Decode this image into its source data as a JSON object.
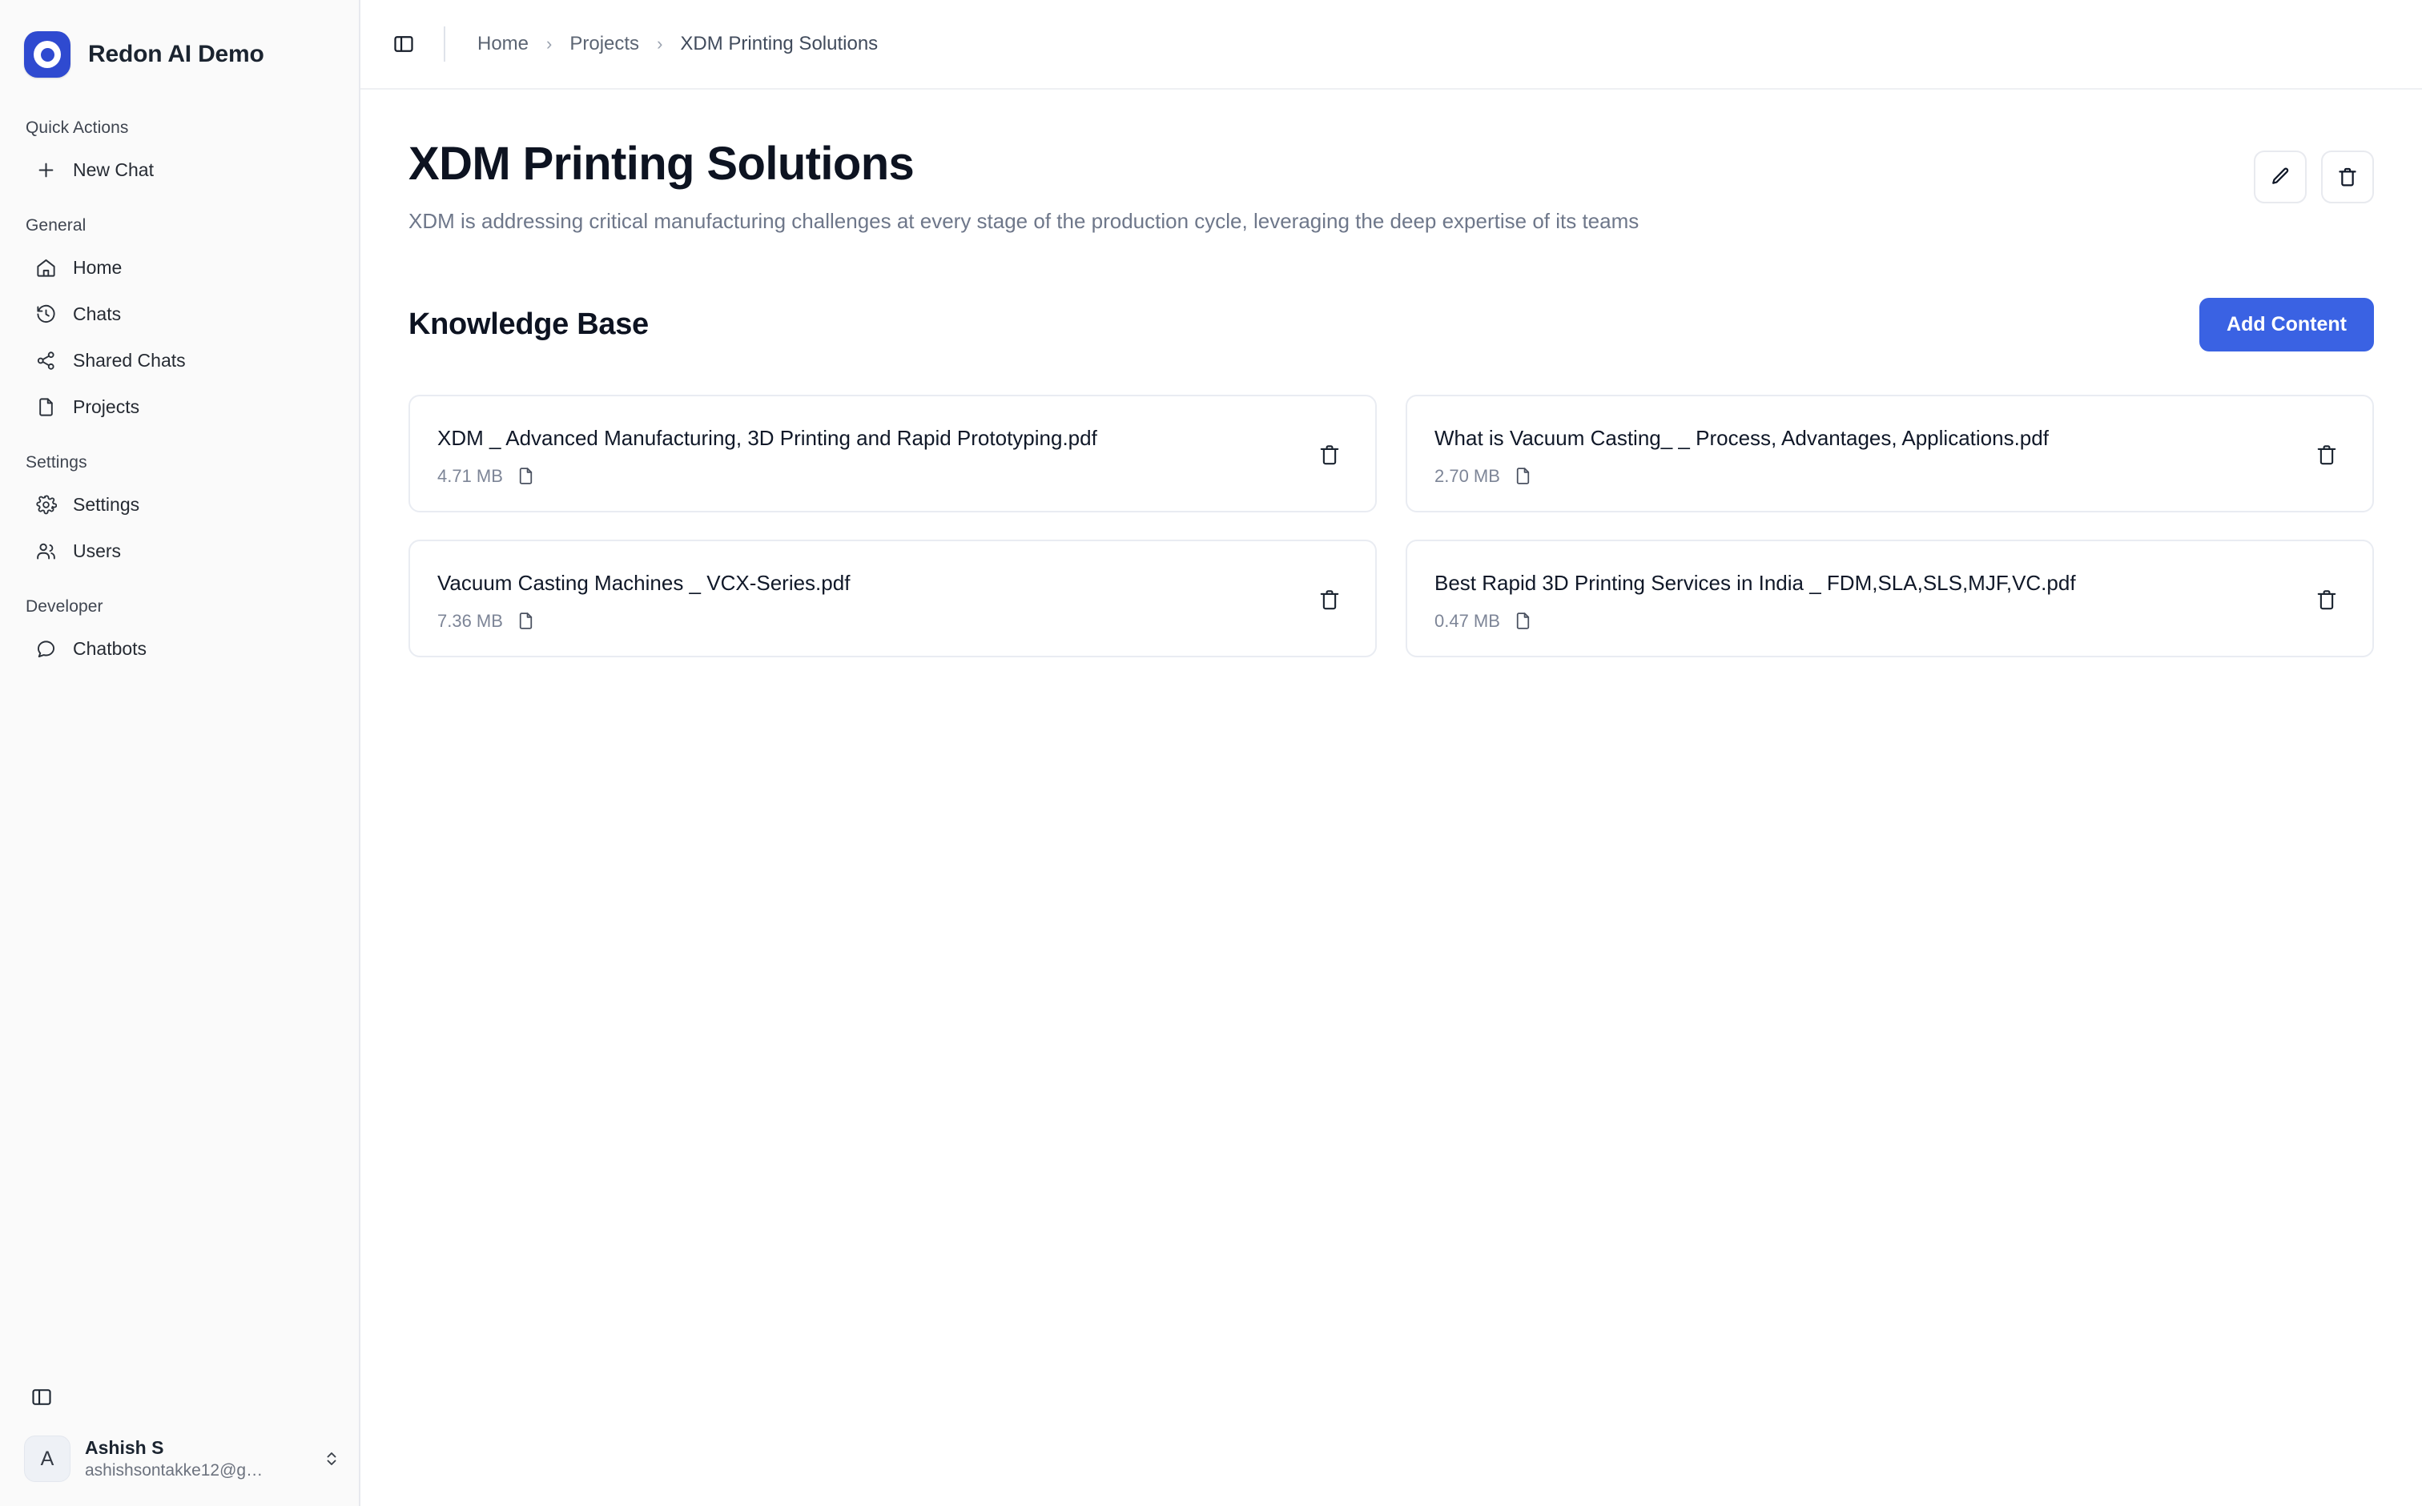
{
  "brand": {
    "name": "Redon AI Demo",
    "logo_icon": "target-circle-icon",
    "accent": "#3a62e3"
  },
  "sidebar": {
    "groups": [
      {
        "label": "Quick Actions",
        "items": [
          {
            "label": "New Chat",
            "icon": "plus-icon"
          }
        ]
      },
      {
        "label": "General",
        "items": [
          {
            "label": "Home",
            "icon": "home-icon"
          },
          {
            "label": "Chats",
            "icon": "history-clock-icon"
          },
          {
            "label": "Shared Chats",
            "icon": "share-nodes-icon"
          },
          {
            "label": "Projects",
            "icon": "file-icon"
          }
        ]
      },
      {
        "label": "Settings",
        "items": [
          {
            "label": "Settings",
            "icon": "gear-icon"
          },
          {
            "label": "Users",
            "icon": "users-icon"
          }
        ]
      },
      {
        "label": "Developer",
        "items": [
          {
            "label": "Chatbots",
            "icon": "message-circle-icon"
          }
        ]
      }
    ],
    "panel_toggle_icon": "sidebar-panel-icon",
    "user": {
      "avatar_initial": "A",
      "name": "Ashish S",
      "email": "ashishsontakke12@g…",
      "switcher_icon": "chevrons-up-down-icon"
    }
  },
  "topbar": {
    "panel_toggle_icon": "sidebar-panel-icon",
    "breadcrumb": [
      {
        "label": "Home",
        "current": false
      },
      {
        "label": "Projects",
        "current": false
      },
      {
        "label": "XDM Printing Solutions",
        "current": true
      }
    ],
    "separator": "›"
  },
  "page": {
    "title": "XDM Printing Solutions",
    "subtitle": "XDM is addressing critical manufacturing challenges at every stage of the production cycle, leveraging the deep expertise of its teams",
    "edit_icon": "pencil-icon",
    "delete_icon": "trash-icon"
  },
  "knowledge_base": {
    "title": "Knowledge Base",
    "add_button_label": "Add Content",
    "items": [
      {
        "name": "XDM _ Advanced Manufacturing, 3D Printing and Rapid Prototyping.pdf",
        "size": "4.71 MB",
        "file_icon": "file-icon",
        "delete_icon": "trash-icon"
      },
      {
        "name": "What is Vacuum Casting_ _ Process, Advantages, Applications.pdf",
        "size": "2.70 MB",
        "file_icon": "file-icon",
        "delete_icon": "trash-icon"
      },
      {
        "name": "Vacuum Casting Machines _ VCX-Series.pdf",
        "size": "7.36 MB",
        "file_icon": "file-icon",
        "delete_icon": "trash-icon"
      },
      {
        "name": "Best Rapid 3D Printing Services in India _ FDM,SLA,SLS,MJF,VC.pdf",
        "size": "0.47 MB",
        "file_icon": "file-icon",
        "delete_icon": "trash-icon"
      }
    ]
  }
}
